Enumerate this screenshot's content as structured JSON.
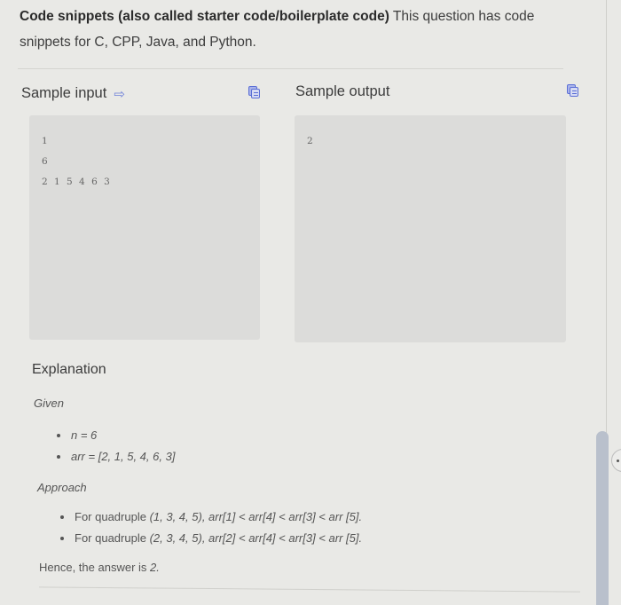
{
  "intro": {
    "bold": "Code snippets (also called starter code/boilerplate code)",
    "rest": " This question has code snippets for C, CPP, Java, and Python."
  },
  "sample_input": {
    "title": "Sample input",
    "lines": [
      "1",
      "6",
      "2 1 5 4 6 3"
    ]
  },
  "sample_output": {
    "title": "Sample output",
    "lines": [
      "2"
    ]
  },
  "explanation": {
    "title": "Explanation",
    "given_label": "Given",
    "given": [
      "n = 6",
      "arr = [2, 1, 5, 4, 6, 3]"
    ],
    "approach_label": "Approach",
    "approach": [
      {
        "prefix": "For quadruple ",
        "tuple": "(1, 3, 4, 5)",
        "expr": ", arr[1] < arr[4] < arr[3] < arr [5]."
      },
      {
        "prefix": "For quadruple ",
        "tuple": "(2, 3, 4, 5)",
        "expr": ", arr[2] < arr[4] < arr[3] < arr [5]."
      }
    ],
    "conclusion_prefix": "Hence, the answer is ",
    "conclusion_value": "2."
  },
  "icons": {
    "input_arrow": "⇨",
    "accent": "#5b6fd6"
  }
}
